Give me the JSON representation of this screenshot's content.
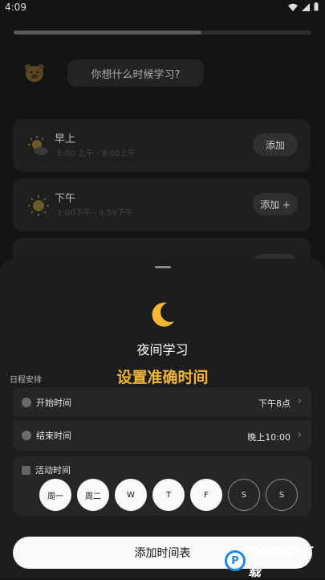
{
  "status_bar": {
    "time": "4:09"
  },
  "onboarding": {
    "progress": 0.63
  },
  "prompt": {
    "question": "你想什么时候学习?"
  },
  "time_slots": [
    {
      "name": "早上",
      "range": "6:00 上午 - 9:00上午",
      "add_label": "添加"
    },
    {
      "name": "下午",
      "range": "1:00下午 - 4:59下午",
      "add_label": "添加 +"
    }
  ],
  "sheet": {
    "title": "夜间学习",
    "section_label": "日程安排",
    "promo_caption": "设置准确时间",
    "start": {
      "label": "开始时间",
      "value": "下午8点"
    },
    "end": {
      "label": "结束时间",
      "value": "晚上10:00"
    },
    "activity": {
      "label": "活动时间",
      "days": [
        "周一",
        "周二",
        "W",
        "T",
        "F",
        "S",
        "S"
      ]
    },
    "cta": "添加时间表"
  },
  "watermark": {
    "logo_letter": "P",
    "text": "PCPOP下载"
  },
  "colors": {
    "accent": "#f0b63a",
    "moon": "#f5b731",
    "watermark_blue": "#1e88e5"
  }
}
